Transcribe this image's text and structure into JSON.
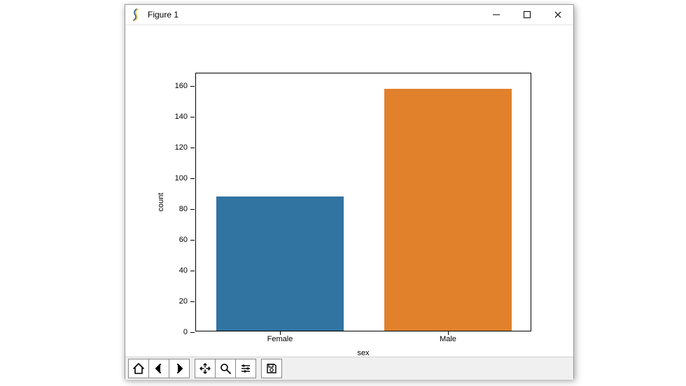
{
  "window": {
    "title": "Figure 1",
    "buttons": {
      "minimize": "Minimize",
      "maximize": "Maximize",
      "close": "Close"
    }
  },
  "toolbar": {
    "items": [
      "home",
      "back",
      "forward",
      "pan",
      "zoom",
      "configure",
      "save"
    ]
  },
  "chart_data": {
    "type": "bar",
    "categories": [
      "Female",
      "Male"
    ],
    "values": [
      87,
      157
    ],
    "x_tick_labels": [
      "Female",
      "Male"
    ],
    "xlabel": "sex",
    "ylabel": "count",
    "ylim": [
      0,
      168
    ],
    "yticks": [
      0,
      20,
      40,
      60,
      80,
      100,
      120,
      140,
      160
    ],
    "x_positions_frac": [
      0.25,
      0.75
    ],
    "bar_width_frac": 0.38,
    "colors": {
      "Female": "#3274a1",
      "Male": "#e1812c"
    }
  }
}
